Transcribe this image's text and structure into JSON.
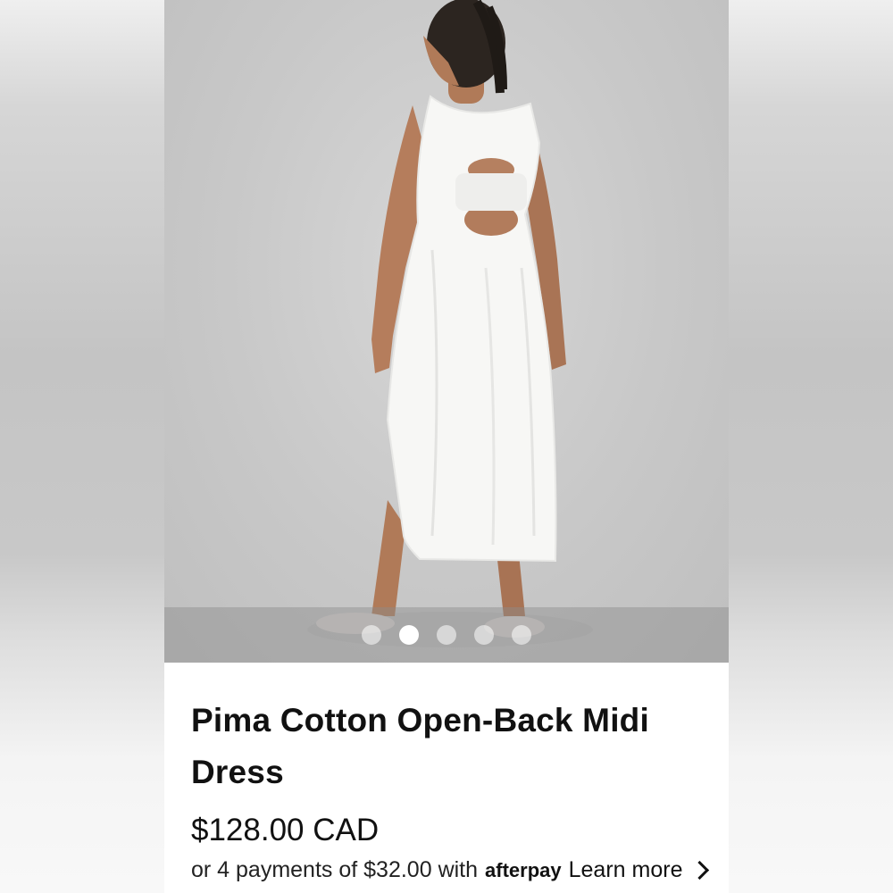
{
  "product": {
    "title": "Pima Cotton Open-Back Midi Dress",
    "price": "$128.00 CAD",
    "installments_text": "or 4 payments of $32.00 with",
    "afterpay_label": "afterpay",
    "learn_more": "Learn more"
  },
  "carousel": {
    "total_slides": 5,
    "active_index": 1
  },
  "image": {
    "alt": "Model wearing white open-back midi dress, back view"
  },
  "colors": {
    "background": "#c9c9c9",
    "dress": "#f7f7f5",
    "text": "#111111"
  }
}
